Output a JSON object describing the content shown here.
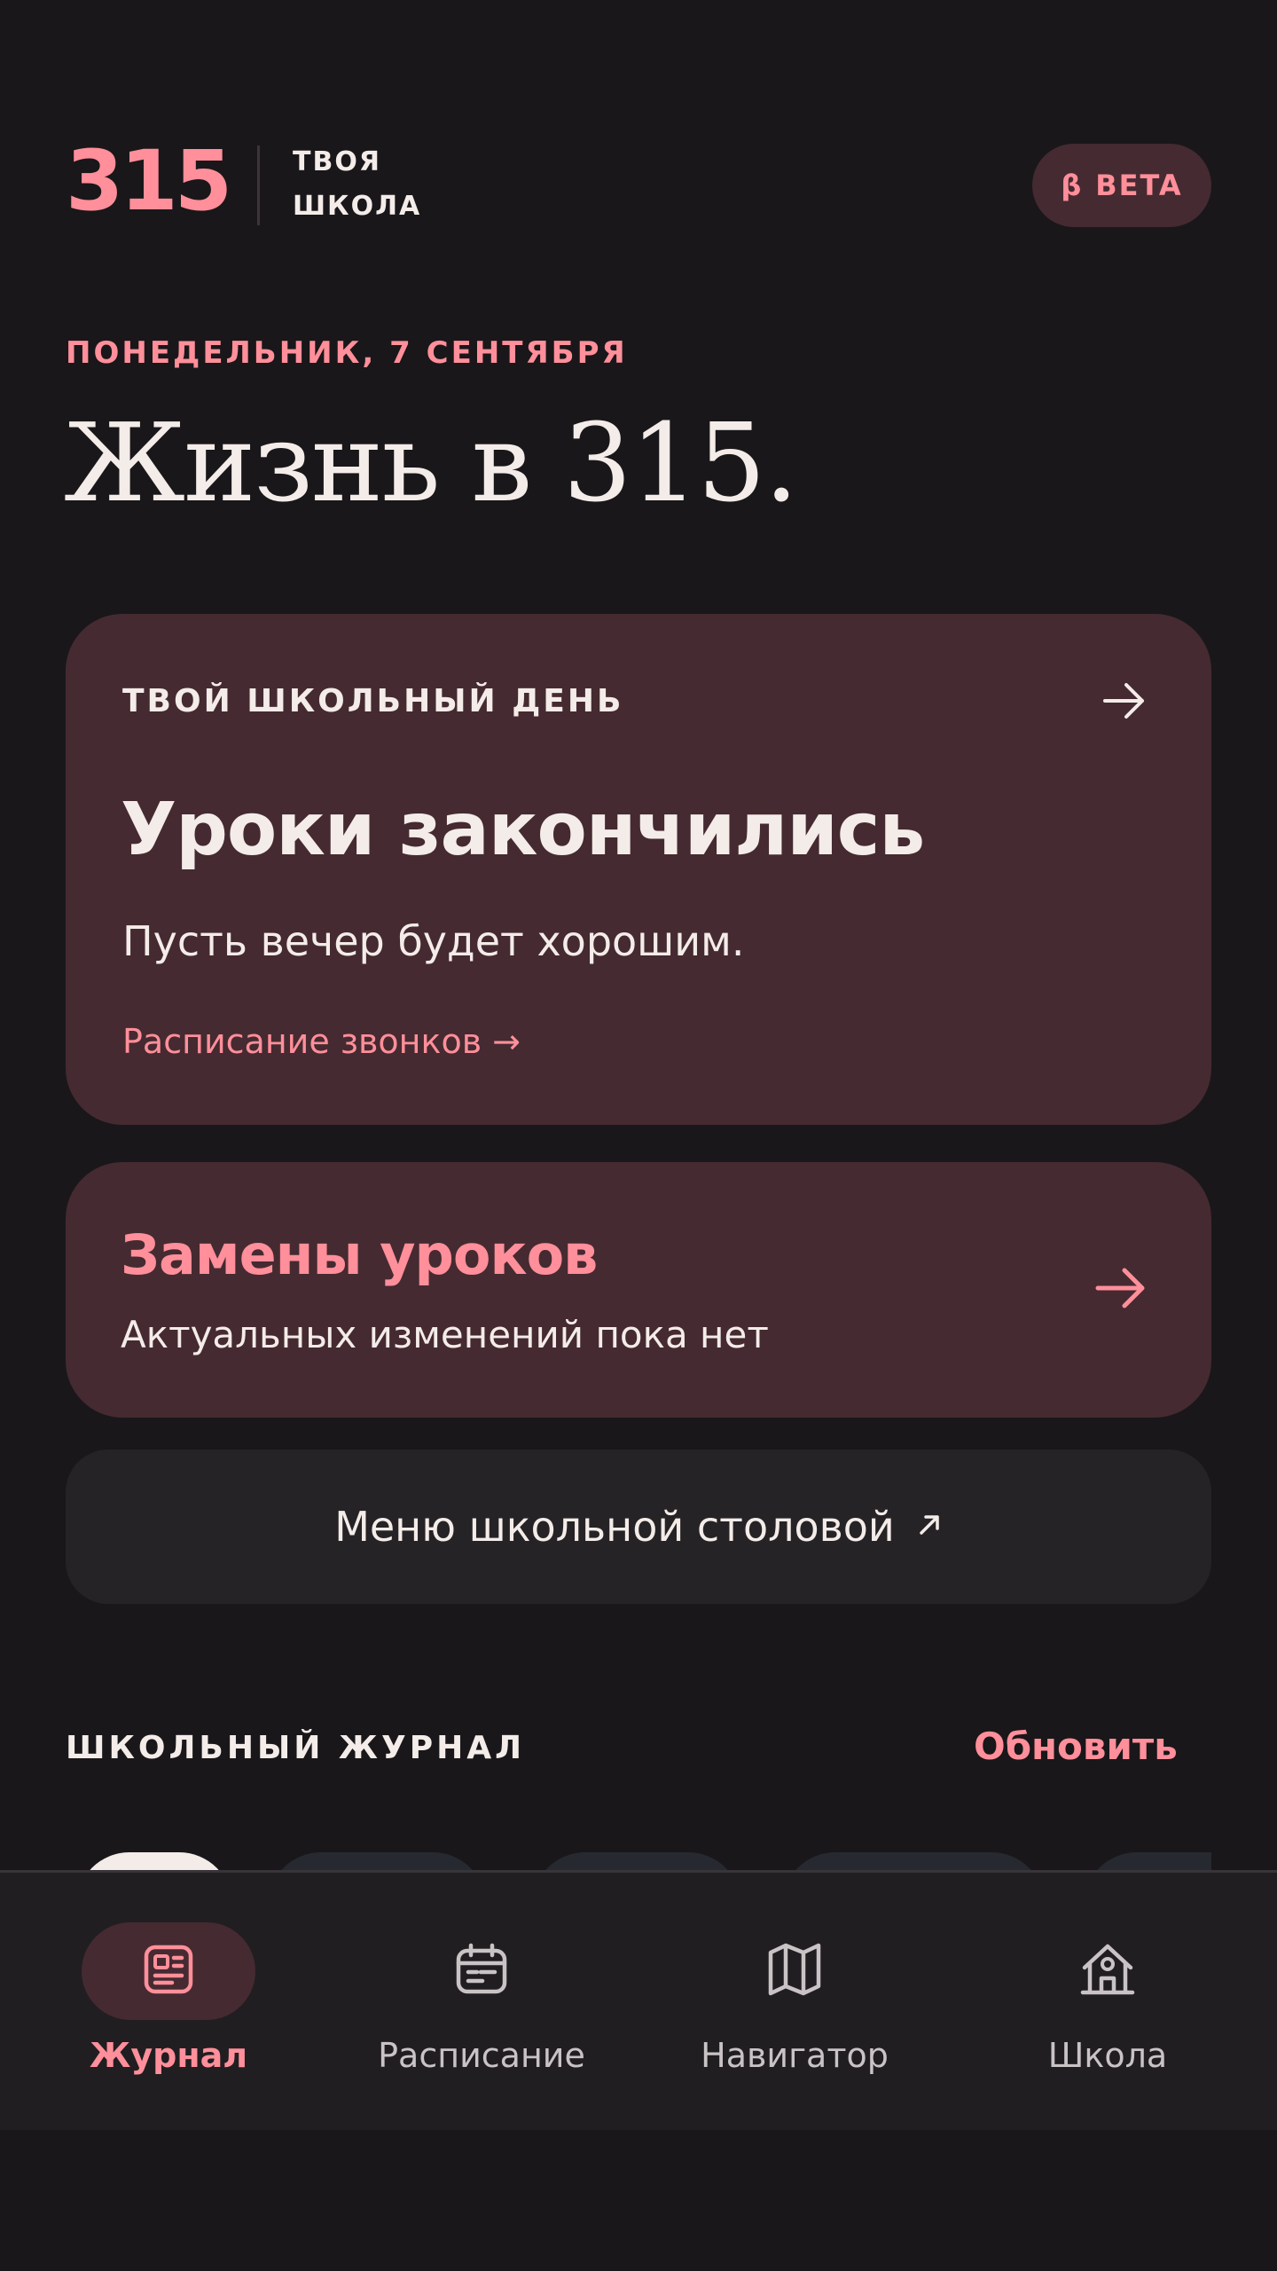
{
  "header": {
    "logo_number": "315",
    "logo_line1": "ТВОЯ",
    "logo_line2": "ШКОЛА",
    "beta_symbol": "β",
    "beta_label": "BETA"
  },
  "date_line": "ПОНЕДЕЛЬНИК, 7 СЕНТЯБРЯ",
  "page_title": "Жизнь в 315.",
  "school_day_card": {
    "label": "ТВОЙ ШКОЛЬНЫЙ ДЕНЬ",
    "heading": "Уроки закончились",
    "subtitle": "Пусть вечер будет хорошим.",
    "link": "Расписание звонков →",
    "icon": "arrow-right-icon"
  },
  "substitutions_card": {
    "title": "Замены уроков",
    "subtitle": "Актуальных изменений пока нет",
    "icon": "arrow-right-icon"
  },
  "canteen_menu": {
    "label": "Меню школьной столовой",
    "icon": "external-arrow-icon"
  },
  "journal_section": {
    "title": "ШКОЛЬНЫЙ ЖУРНАЛ",
    "refresh_label": "Обновить"
  },
  "bottom_nav": {
    "items": [
      {
        "label": "Журнал",
        "icon": "journal-icon",
        "active": true
      },
      {
        "label": "Расписание",
        "icon": "calendar-icon",
        "active": false
      },
      {
        "label": "Навигатор",
        "icon": "map-icon",
        "active": false
      },
      {
        "label": "Школа",
        "icon": "school-icon",
        "active": false
      }
    ]
  },
  "colors": {
    "background": "#19171a",
    "accent": "#ff8f9a",
    "card": "#452a31",
    "card_dark": "#262326",
    "text": "#f4ece9",
    "nav_background": "#211e21"
  }
}
